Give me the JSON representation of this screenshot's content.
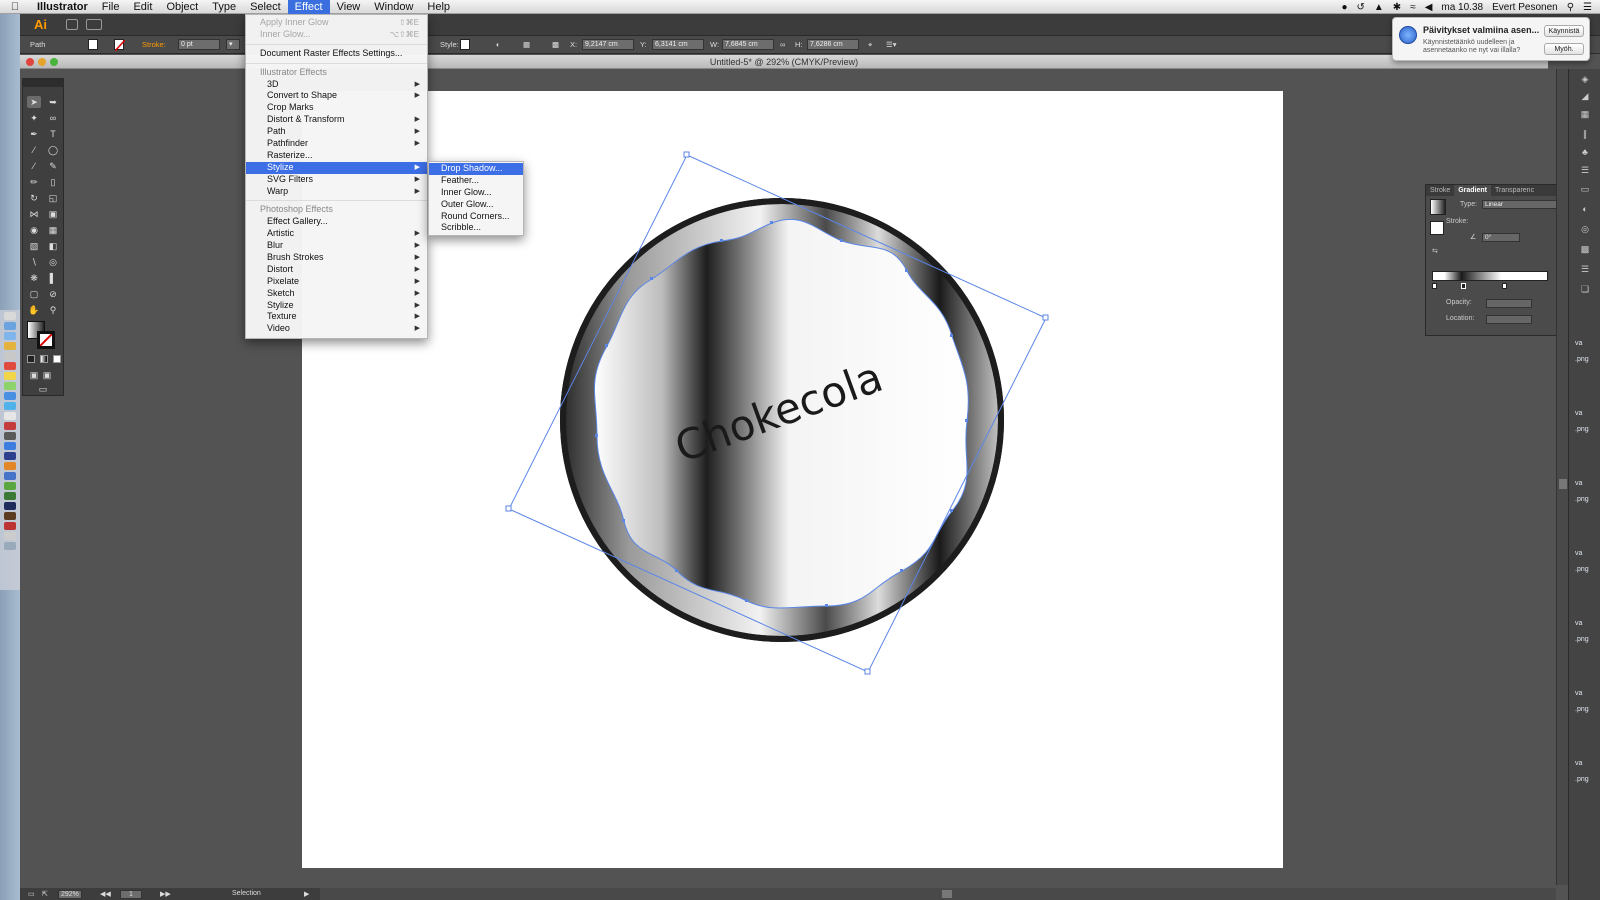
{
  "menubar": {
    "app": "Illustrator",
    "items": [
      "File",
      "Edit",
      "Object",
      "Type",
      "Select",
      "Effect",
      "View",
      "Window",
      "Help"
    ],
    "active": "Effect",
    "clock": "ma 10.38",
    "user": "Evert Pesonen"
  },
  "appbar": {
    "logo": "Ai"
  },
  "controlbar": {
    "selection_type": "Path",
    "stroke_label": "Stroke:",
    "stroke_value": "0 pt",
    "style_label": "Style:",
    "x_label": "X:",
    "x_value": "9,2147 cm",
    "y_label": "Y:",
    "y_value": "6,3141 cm",
    "w_label": "W:",
    "w_value": "7,6845 cm",
    "h_label": "H:",
    "h_value": "7,6286 cm"
  },
  "document": {
    "title": "Untitled-5* @ 292% (CMYK/Preview)"
  },
  "artwork": {
    "text": "Chokecola"
  },
  "effect_menu": {
    "apply_last": "Apply Inner Glow",
    "apply_last_shortcut": "⇧⌘E",
    "last_effect": "Inner Glow...",
    "last_effect_shortcut": "⌥⇧⌘E",
    "doc_raster": "Document Raster Effects Settings...",
    "illustrator_header": "Illustrator Effects",
    "illustrator_items": [
      "3D",
      "Convert to Shape",
      "Crop Marks",
      "Distort & Transform",
      "Path",
      "Pathfinder",
      "Rasterize...",
      "Stylize",
      "SVG Filters",
      "Warp"
    ],
    "illustrator_has_submenu": [
      true,
      true,
      false,
      true,
      true,
      true,
      false,
      true,
      true,
      true
    ],
    "highlighted": "Stylize",
    "photoshop_header": "Photoshop Effects",
    "photoshop_items": [
      "Effect Gallery...",
      "Artistic",
      "Blur",
      "Brush Strokes",
      "Distort",
      "Pixelate",
      "Sketch",
      "Stylize",
      "Texture",
      "Video"
    ],
    "photoshop_has_submenu": [
      false,
      true,
      true,
      true,
      true,
      true,
      true,
      true,
      true,
      true
    ]
  },
  "stylize_submenu": {
    "items": [
      "Drop Shadow...",
      "Feather...",
      "Inner Glow...",
      "Outer Glow...",
      "Round Corners...",
      "Scribble..."
    ],
    "highlighted": "Drop Shadow..."
  },
  "notification": {
    "title": "Päivitykset valmiina asen...",
    "text": "Käynnistetäänkö uudelleen ja asennetaanko ne nyt vai illalla?",
    "primary_button": "Käynnistä",
    "secondary_button": "Myöh."
  },
  "gradient_panel": {
    "tabs": [
      "Stroke",
      "Gradient",
      "Transparenc"
    ],
    "active_tab": "Gradient",
    "type_label": "Type:",
    "type_value": "Linear",
    "stroke_label": "Stroke:",
    "angle_value": "0°",
    "opacity_label": "Opacity:",
    "location_label": "Location:"
  },
  "statusbar": {
    "zoom": "292%",
    "artboard": "1",
    "tool": "Selection"
  },
  "desktop_files": [
    "va",
    ".png",
    "va",
    ".png",
    "va",
    ".png",
    "va",
    ".png",
    "va",
    ".png",
    "va",
    ".png",
    "va",
    ".png"
  ],
  "colors": {
    "menu_highlight": "#3c6ee6",
    "selection_blue": "#5b86e6",
    "ai_orange": "#ff9a00"
  }
}
